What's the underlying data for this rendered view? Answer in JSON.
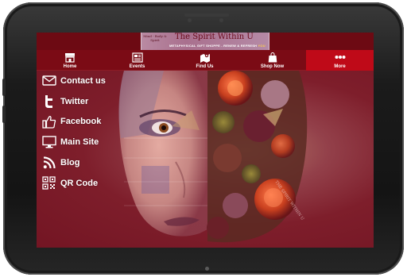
{
  "banner": {
    "side_text": "Mind - Body & Spirit",
    "title": "The Spirit Within U",
    "subtitle": "METAPHYSICAL GIFT SHOPPE - RENEW & REFRESH",
    "subtitle_emph": "YOU"
  },
  "nav": {
    "items": [
      {
        "label": "Home",
        "icon": "store-icon"
      },
      {
        "label": "Events",
        "icon": "newspaper-icon"
      },
      {
        "label": "Find Us",
        "icon": "map-icon"
      },
      {
        "label": "Shop Now",
        "icon": "shopping-bag-icon"
      },
      {
        "label": "More",
        "icon": "more-dots-icon",
        "active": true
      }
    ]
  },
  "menu": {
    "items": [
      {
        "label": "Contact us",
        "icon": "envelope-icon"
      },
      {
        "label": "Twitter",
        "icon": "twitter-icon"
      },
      {
        "label": "Facebook",
        "icon": "thumbs-up-icon"
      },
      {
        "label": "Main Site",
        "icon": "monitor-icon"
      },
      {
        "label": "Blog",
        "icon": "rss-icon"
      },
      {
        "label": "QR Code",
        "icon": "qr-code-icon"
      }
    ]
  },
  "artwork": {
    "watermark": "THE SPIRIT WITHIN U"
  },
  "colors": {
    "nav_bg": "#7b0b15",
    "nav_active": "#bf0a18",
    "content_bg": "#7a1623"
  }
}
